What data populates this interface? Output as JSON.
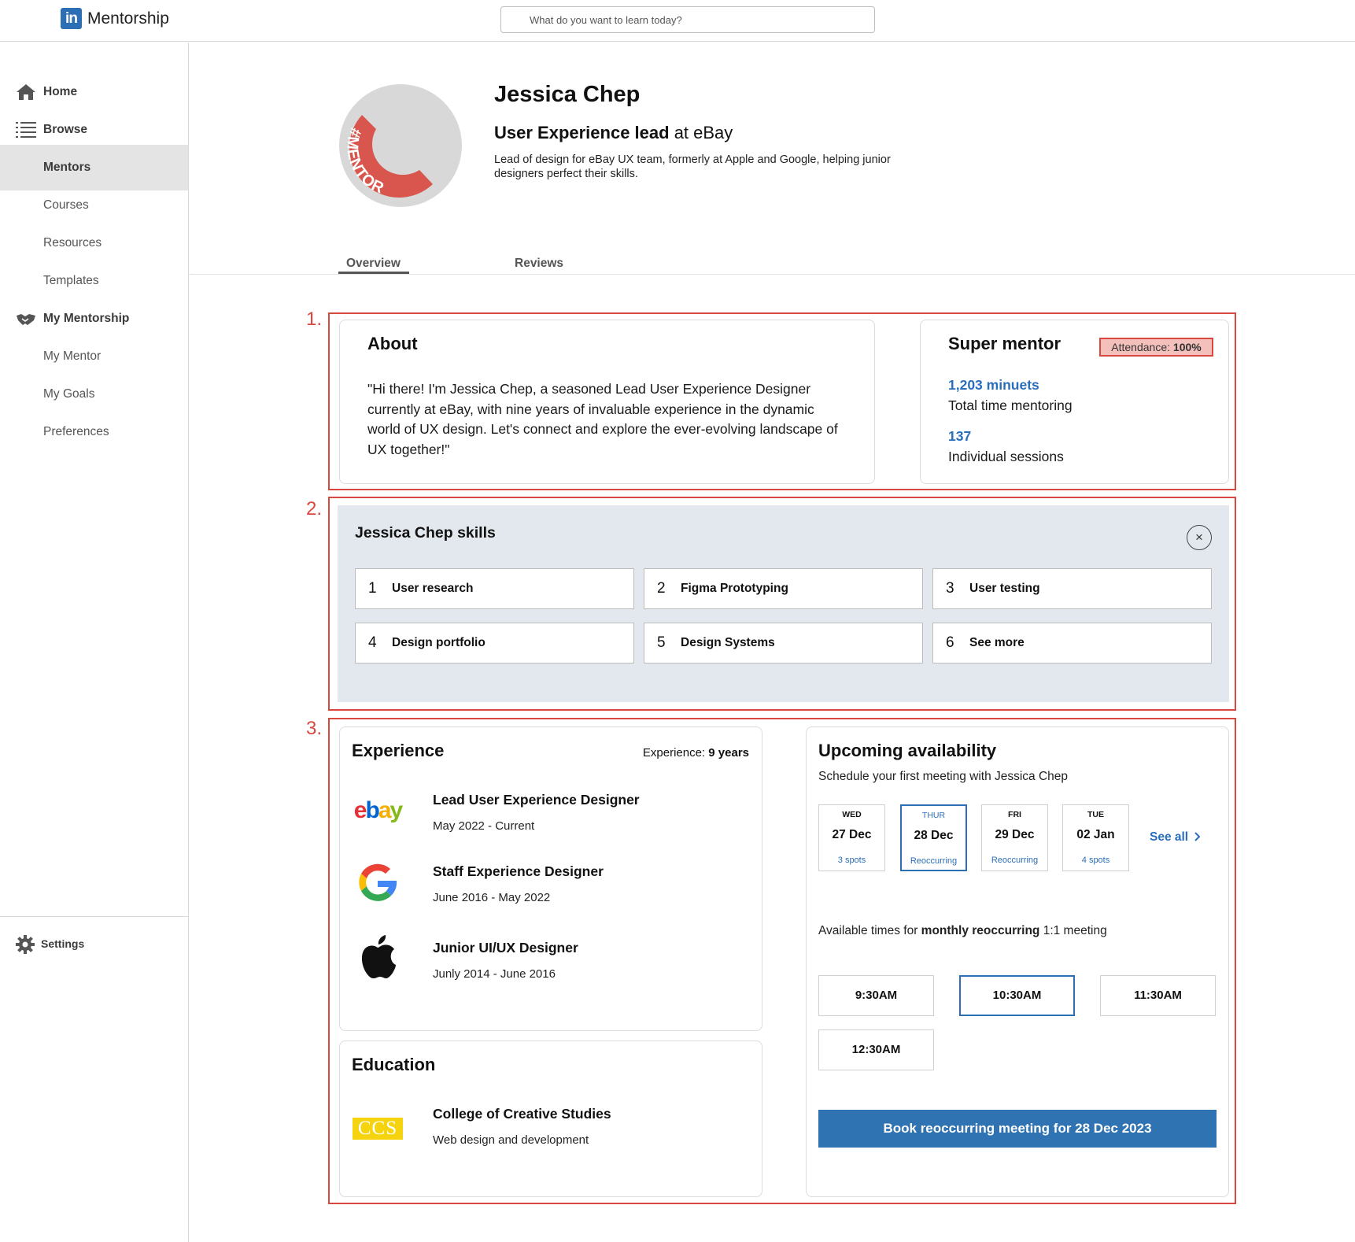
{
  "header": {
    "brand_logo_text": "in",
    "brand_name": "Mentorship",
    "search_placeholder": "What do you want to learn today?"
  },
  "sidebar": {
    "items": [
      {
        "label": "Home",
        "icon": "home-icon"
      },
      {
        "label": "Browse",
        "icon": "list-icon"
      },
      {
        "label": "Mentors",
        "active": true
      },
      {
        "label": "Courses"
      },
      {
        "label": "Resources"
      },
      {
        "label": "Templates"
      },
      {
        "label": "My Mentorship",
        "icon": "handshake-icon"
      },
      {
        "label": "My Mentor"
      },
      {
        "label": "My Goals"
      },
      {
        "label": "Preferences"
      }
    ],
    "settings_label": "Settings"
  },
  "profile": {
    "avatar_badge": "#MENTOR",
    "name": "Jessica Chep",
    "role_title": "User Experience lead",
    "role_company": " at eBay",
    "bio": "Lead of design for eBay UX team, formerly  at Apple and Google, helping junior designers perfect their skills."
  },
  "tabs": {
    "overview": "Overview",
    "reviews": "Reviews"
  },
  "annotations": {
    "one": "1.",
    "two": "2.",
    "three": "3."
  },
  "about": {
    "title": "About",
    "text": "\"Hi there! I'm Jessica Chep, a seasoned Lead User Experience Designer currently at eBay, with nine years of invaluable experience in the dynamic world of UX design. Let's connect and explore the ever-evolving landscape of UX together!\""
  },
  "super_mentor": {
    "title": "Super mentor",
    "attendance_label": "Attendance: ",
    "attendance_value": "100%",
    "minutes_value": "1,203 minuets",
    "minutes_label": "Total time mentoring",
    "sessions_value": "137",
    "sessions_label": "Individual sessions"
  },
  "skills": {
    "title": "Jessica Chep skills",
    "close": "×",
    "items": [
      {
        "num": "1",
        "label": "User research"
      },
      {
        "num": "2",
        "label": "Figma Prototyping"
      },
      {
        "num": "3",
        "label": "User testing"
      },
      {
        "num": "4",
        "label": "Design portfolio"
      },
      {
        "num": "5",
        "label": "Design Systems"
      },
      {
        "num": "6",
        "label": "See more"
      }
    ]
  },
  "experience": {
    "title": "Experience",
    "years_label": "Experience: ",
    "years_value": "9 years",
    "jobs": [
      {
        "title": "Lead User Experience Designer",
        "dates": "May 2022 - Current",
        "logo": "ebay-logo"
      },
      {
        "title": "Staff Experience Designer",
        "dates": "June 2016 - May 2022",
        "logo": "google-logo"
      },
      {
        "title": "Junior UI/UX Designer",
        "dates": "Junly 2014 - June 2016",
        "logo": "apple-logo"
      }
    ]
  },
  "education": {
    "title": "Education",
    "school": "College of Creative Studies",
    "program": "Web design and development",
    "logo_text": "CCS"
  },
  "availability": {
    "title": "Upcoming availability",
    "subtitle": "Schedule your first meeting with Jessica Chep",
    "days": [
      {
        "weekday": "WED",
        "date": "27 Dec",
        "note": "3 spots"
      },
      {
        "weekday": "THUR",
        "date": "28 Dec",
        "note": "Reoccurring",
        "selected": true
      },
      {
        "weekday": "FRI",
        "date": "29 Dec",
        "note": "Reoccurring"
      },
      {
        "weekday": "TUE",
        "date": "02 Jan",
        "note": "4 spots"
      }
    ],
    "see_all": "See all",
    "times_prefix": "Available times for ",
    "times_bold": "monthly reoccurring",
    "times_suffix": " 1:1 meeting",
    "slots": [
      {
        "time": "9:30AM"
      },
      {
        "time": "10:30AM",
        "selected": true
      },
      {
        "time": "11:30AM"
      },
      {
        "time": "12:30AM"
      }
    ],
    "book_button": "Book reoccurring meeting for 28 Dec 2023"
  },
  "colors": {
    "brand_blue": "#2d6fb5",
    "link_blue": "#2a6ebb",
    "annotation_red": "#d8483e",
    "skills_bg": "#e2e8ee"
  }
}
